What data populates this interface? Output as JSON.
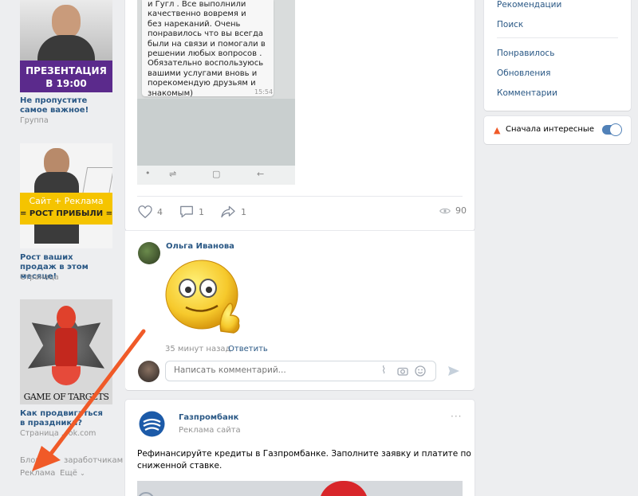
{
  "left_ads": [
    {
      "banner_text_1": "ПРЕЗЕНТАЦИЯ",
      "banner_text_2": "В 19:00",
      "title": "Не пропустите самое важное!",
      "subtitle": "Группа"
    },
    {
      "banner_text_1": "Сайт + Реклама",
      "banner_text_2": "= РОСТ ПРИБЫЛИ =",
      "title": "Рост ваших продаж в этом месяце!",
      "subtitle": "Страница"
    },
    {
      "banner_text_1": "GAME OF TARGETS",
      "title": "Как продвигаться в праздники?",
      "subtitle": "Страница ...ok.com"
    }
  ],
  "left_footer": {
    "blog": "Блог",
    "blog_tail": "заработчикам",
    "ads": "Реклама",
    "more": "Ещё"
  },
  "post1": {
    "chat_lines": [
      "и Гугл . Все выполнили",
      "качественно вовремя и",
      "без нареканий. Очень",
      "понравилось что вы всегда",
      "были на связи и помогали в",
      "решении любых вопросов .",
      "Обязательно воспользуюсь",
      "вашими услугами вновь и",
      "порекомендую друзьям и",
      "знакомым)"
    ],
    "chat_time": "15:54",
    "likes": "4",
    "comments": "1",
    "shares": "1",
    "views": "90"
  },
  "comment": {
    "author": "Ольга Иванова",
    "time": "35 минут назад",
    "reply": "Ответить",
    "input_placeholder": "Написать комментарий..."
  },
  "post2": {
    "author": "Газпромбанк",
    "subtitle": "Реклама сайта",
    "more": "···",
    "text_line1": "Рефинансируйте кредиты в Газпромбанке. Заполните заявку и платите по",
    "text_line2": "сниженной ставке."
  },
  "right_menu": {
    "group1": [
      "Рекомендации",
      "Поиск"
    ],
    "group2": [
      "Понравилось",
      "Обновления",
      "Комментарии"
    ],
    "interesting_first": "Сначала интересные"
  },
  "colors": {
    "link": "#2a5885",
    "accent": "#5181b8",
    "arrow": "#f05a28",
    "bg": "#edeef0"
  }
}
